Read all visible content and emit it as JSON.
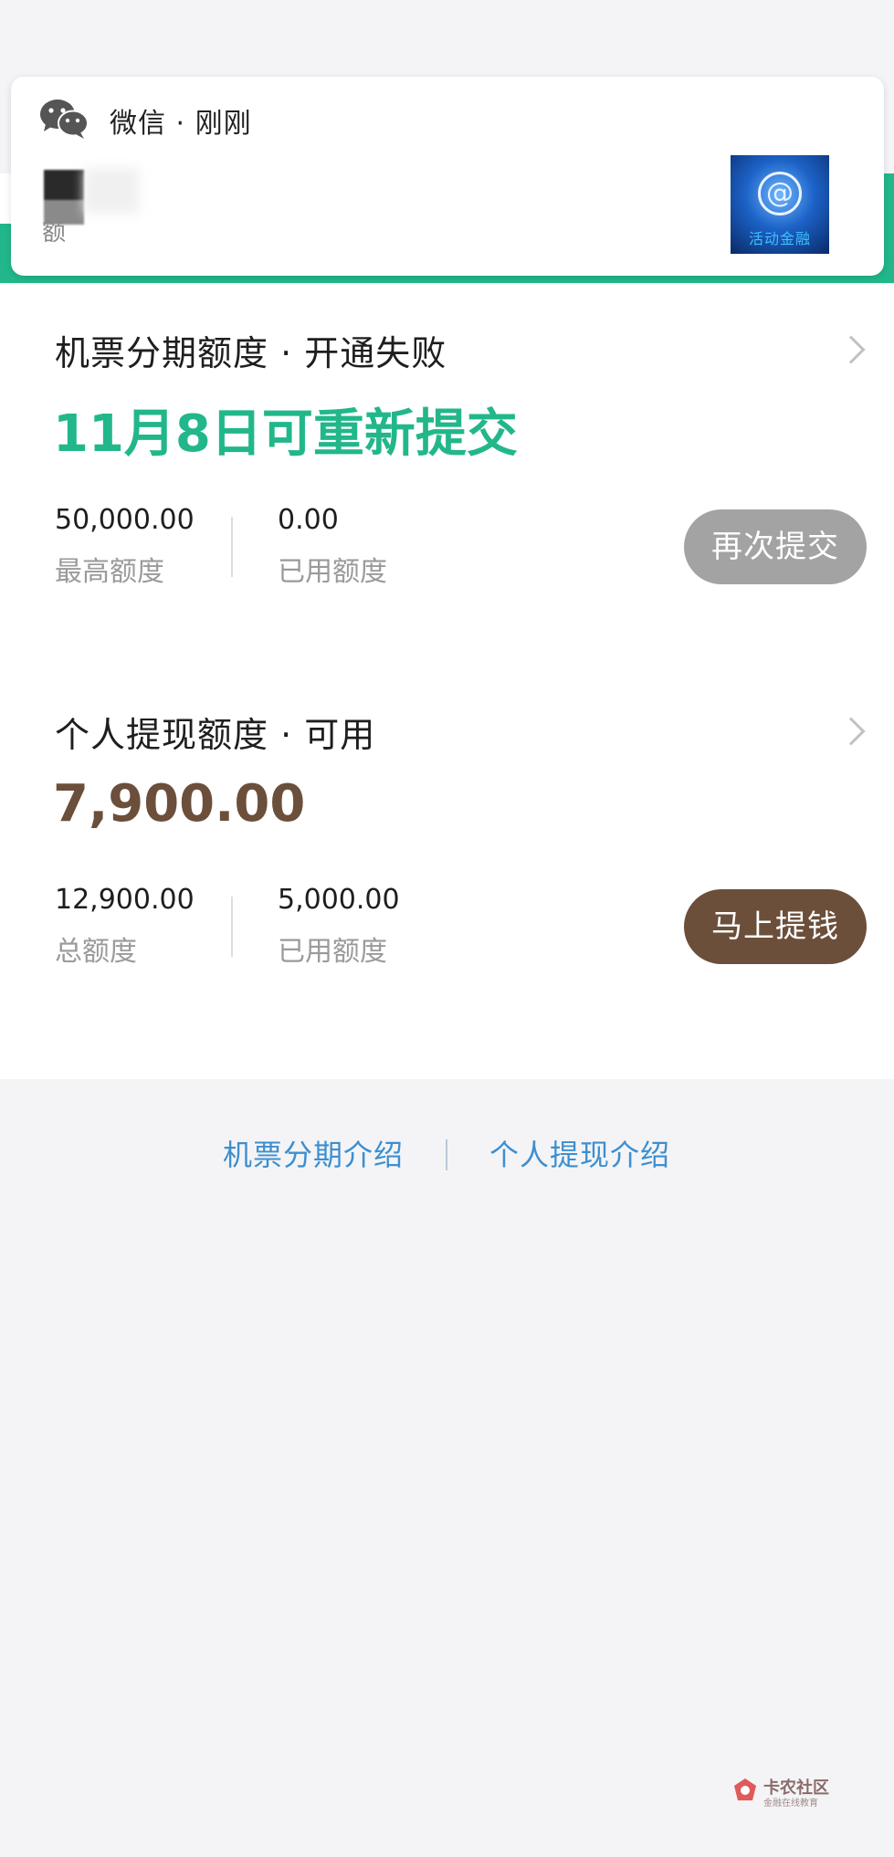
{
  "notification": {
    "source_label": "微信 · 刚刚",
    "preview_text": "额",
    "thumb_symbol": "@",
    "thumb_caption": "活动金融"
  },
  "flight_installment": {
    "title": "机票分期额度 · 开通失败",
    "status_text": "11月8日可重新提交",
    "status_color": "#22b78a",
    "stats": [
      {
        "value": "50,000.00",
        "label": "最高额度"
      },
      {
        "value": "0.00",
        "label": "已用额度"
      }
    ],
    "button_label": "再次提交",
    "button_color": "#a3a3a3"
  },
  "personal_withdraw": {
    "title": "个人提现额度 · 可用",
    "available_amount": "7,900.00",
    "amount_color": "#6b4f3a",
    "stats": [
      {
        "value": "12,900.00",
        "label": "总额度"
      },
      {
        "value": "5,000.00",
        "label": "已用额度"
      }
    ],
    "button_label": "马上提钱",
    "button_color": "#6b4f3a"
  },
  "footer": {
    "links": [
      {
        "label": "机票分期介绍"
      },
      {
        "label": "个人提现介绍"
      }
    ]
  },
  "watermark": {
    "title": "卡农社区",
    "subtitle": "金融在线教育"
  }
}
